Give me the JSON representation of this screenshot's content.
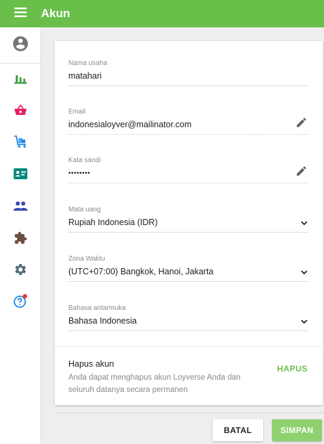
{
  "header": {
    "title": "Akun",
    "bar_color": "#6abf4b",
    "menu_icon": "hamburger-menu-icon"
  },
  "sidebar": {
    "items": [
      {
        "icon": "account-circle-icon",
        "color": "#757575"
      },
      {
        "icon": "bar-chart-icon",
        "color": "#43a047"
      },
      {
        "icon": "shopping-basket-icon",
        "color": "#e91e63"
      },
      {
        "icon": "inventory-cart-icon",
        "color": "#1e88e5"
      },
      {
        "icon": "badge-card-icon",
        "color": "#00897b"
      },
      {
        "icon": "people-icon",
        "color": "#3949ab"
      },
      {
        "icon": "extension-puzzle-icon",
        "color": "#6d4c41"
      },
      {
        "icon": "settings-gear-icon",
        "color": "#546e7a"
      },
      {
        "icon": "help-icon",
        "color": "#1e88e5",
        "badge_color": "#e53935"
      }
    ]
  },
  "form": {
    "business_name": {
      "label": "Nama usaha",
      "value": "matahari"
    },
    "email": {
      "label": "Email",
      "value": "indonesialoyver@mailinator.com",
      "action_icon": "edit-pencil-icon"
    },
    "password": {
      "label": "Kata sandi",
      "value": "••••••••",
      "action_icon": "edit-pencil-icon"
    },
    "currency": {
      "label": "Mata uang",
      "value": "Rupiah Indonesia (IDR)"
    },
    "timezone": {
      "label": "Zona Waktu",
      "value": "(UTC+07:00) Bangkok, Hanoi, Jakarta"
    },
    "language": {
      "label": "Bahasa antarmuka",
      "value": "Bahasa Indonesia"
    }
  },
  "delete_account": {
    "title": "Hapus akun",
    "description": "Anda dapat menghapus akun Loyverse Anda dan seluruh datanya secara permanen",
    "button_label": "HAPUS"
  },
  "actions": {
    "cancel_label": "BATAL",
    "save_label": "SIMPAN"
  }
}
